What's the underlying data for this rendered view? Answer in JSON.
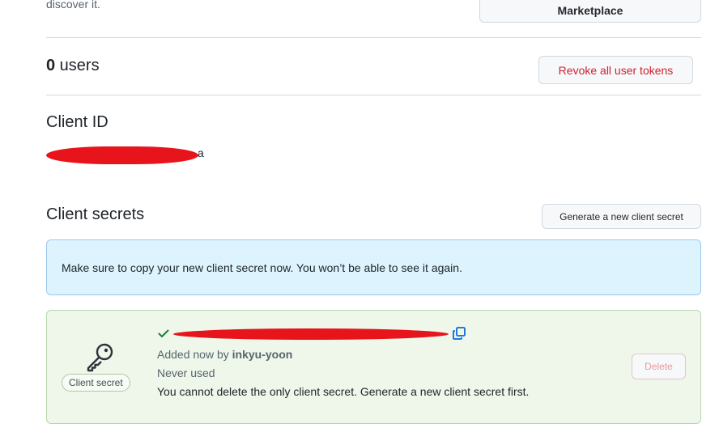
{
  "top": {
    "partial_text": "discover it.",
    "marketplace_button": "Marketplace"
  },
  "users": {
    "count": "0",
    "label": " users",
    "revoke_button": "Revoke all user tokens"
  },
  "client_id": {
    "heading": "Client ID",
    "visible_suffix": "a"
  },
  "client_secrets": {
    "heading": "Client secrets",
    "generate_button": "Generate a new client secret",
    "flash_message": "Make sure to copy your new client secret now. You won’t be able to see it again.",
    "secret": {
      "badge": "Client secret",
      "added_prefix": "Added now by ",
      "added_user": "inkyu-yoon",
      "usage": "Never used",
      "warning": "You cannot delete the only client secret. Generate a new client secret first.",
      "delete_button": "Delete"
    }
  },
  "icons": {
    "key": "key-icon",
    "check": "check-icon",
    "copy": "copy-icon"
  },
  "colors": {
    "danger": "#cf222e",
    "flash_bg": "#ddf4ff",
    "success_bg": "#eef7ea",
    "check": "#1a7f37",
    "link": "#0969da",
    "redaction": "#e8141c"
  }
}
